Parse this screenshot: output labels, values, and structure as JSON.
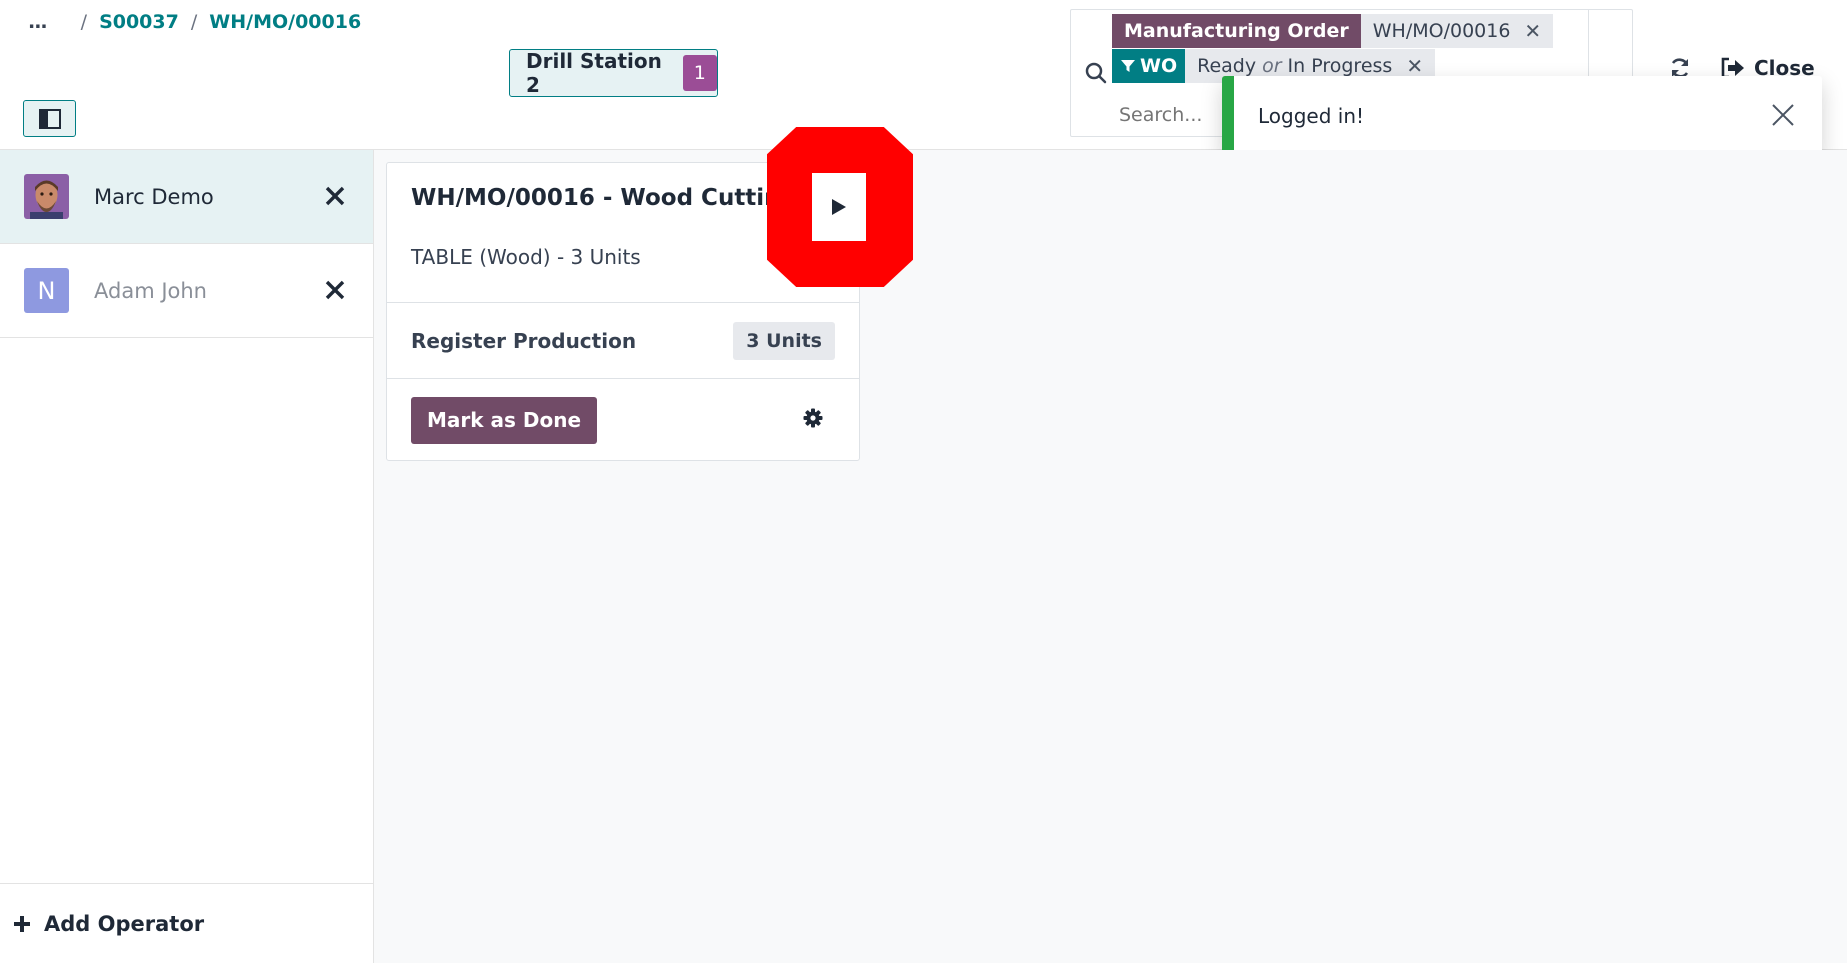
{
  "breadcrumb": {
    "more": "...",
    "items": [
      "S00037",
      "WH/MO/00016"
    ]
  },
  "workcenter": {
    "label": "Drill Station 2",
    "count": "1"
  },
  "search": {
    "placeholder": "Search...",
    "facets": [
      {
        "category": "Manufacturing Order",
        "values": [
          "WH/MO/00016"
        ]
      },
      {
        "category": "WO",
        "values": [
          "Ready",
          "In Progress"
        ],
        "joiner": "or"
      }
    ]
  },
  "header": {
    "close_label": "Close"
  },
  "toast": {
    "message": "Logged in!",
    "accent": "#28a745"
  },
  "operators": [
    {
      "name": "Marc Demo",
      "active": true
    },
    {
      "name": "Adam John",
      "initial": "N",
      "active": false
    }
  ],
  "sidebar": {
    "add_operator_label": "Add Operator"
  },
  "workorder": {
    "title": "WH/MO/00016 - Wood Cutting",
    "product": "TABLE (Wood) - 3 Units",
    "register_label": "Register Production",
    "register_qty": "3 Units",
    "done_label": "Mark as Done"
  },
  "colors": {
    "primary": "#714b67",
    "teal": "#017e84",
    "badge": "#9b4d96"
  }
}
